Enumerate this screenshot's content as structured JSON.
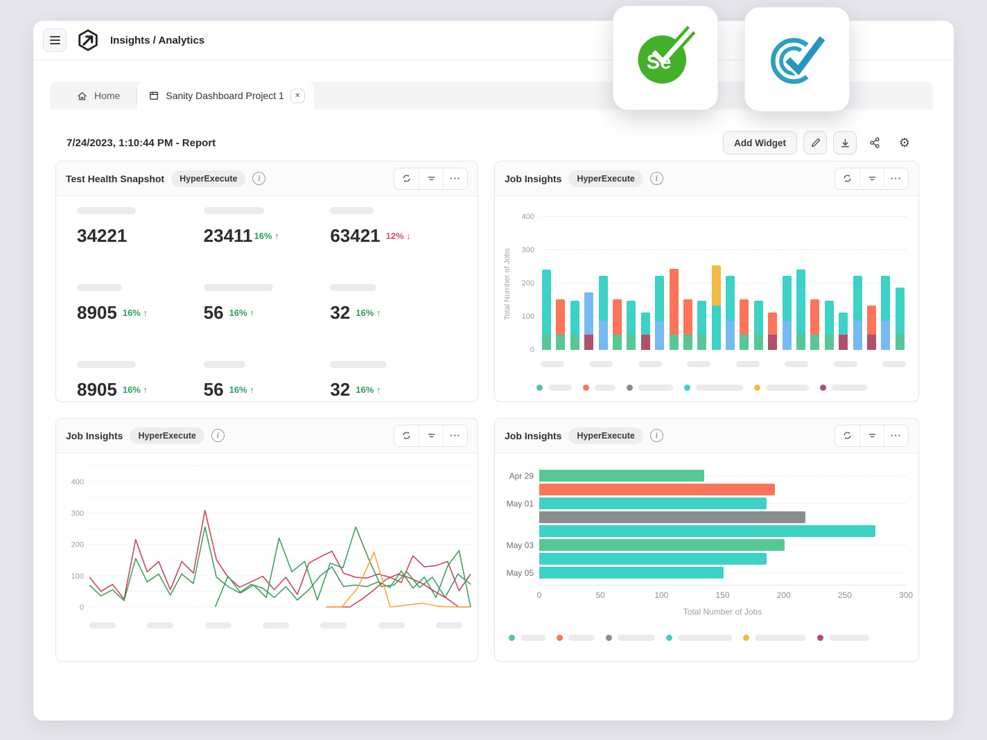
{
  "header": {
    "title": "Insights / Analytics"
  },
  "overlay_cards": {
    "selenium_text": "Se"
  },
  "tabs": {
    "home_label": "Home",
    "active_label": "Sanity Dashboard Project 1",
    "close_glyph": "✕"
  },
  "report": {
    "title": "7/24/2023, 1:10:44 PM - Report",
    "add_widget_label": "Add Widget"
  },
  "colors": {
    "teal": "#3CD2C5",
    "green": "#57C795",
    "orange": "#FC7459",
    "blue": "#75BAF2",
    "maroon": "#B0506B",
    "yellow": "#F2BB45",
    "gray": "#8C8C8C",
    "line_red": "#C2495A",
    "line_green": "#3FA05E",
    "line_yellow": "#F5A93B",
    "delta_up": "#2E9E5B",
    "delta_down": "#D0545E",
    "selenium_green": "#43B02A",
    "codeception_teal": "#2AA0C2"
  },
  "widgets": {
    "test_health": {
      "title": "Test Health Snapshot",
      "badge": "HyperExecute",
      "stats": [
        {
          "pill_w": 85,
          "value": "34221",
          "delta": "",
          "dir": ""
        },
        {
          "pill_w": 87,
          "value": "23411",
          "delta": "16%",
          "dir": "up",
          "tight": true
        },
        {
          "pill_w": 63,
          "value": "63421",
          "delta": "12%",
          "dir": "down"
        },
        {
          "pill_w": 65,
          "value": "8905",
          "delta": "16%",
          "dir": "up"
        },
        {
          "pill_w": 100,
          "value": "56",
          "delta": "16%",
          "dir": "up"
        },
        {
          "pill_w": 67,
          "value": "32",
          "delta": "16%",
          "dir": "up"
        },
        {
          "pill_w": 85,
          "value": "8905",
          "delta": "16%",
          "dir": "up"
        },
        {
          "pill_w": 60,
          "value": "56",
          "delta": "16%",
          "dir": "up"
        },
        {
          "pill_w": 82,
          "value": "32",
          "delta": "16%",
          "dir": "up"
        }
      ]
    },
    "job_insights_bar": {
      "title": "Job Insights",
      "badge": "HyperExecute"
    },
    "job_insights_line": {
      "title": "Job Insights",
      "badge": "HyperExecute"
    },
    "job_insights_hbar": {
      "title": "Job Insights",
      "badge": "HyperExecute"
    }
  },
  "chart_data": [
    {
      "type": "bar",
      "stacked": true,
      "title": "Job Insights",
      "ylabel": "Total Number of Jobs",
      "ylim": [
        0,
        400
      ],
      "yticks": [
        0,
        100,
        200,
        300,
        400
      ],
      "grid": true,
      "x_labels_loading": {
        "count": 8,
        "pill_width": 34
      },
      "bars": [
        [
          [
            "green",
            45
          ],
          [
            "teal",
            197
          ]
        ],
        [
          [
            "green",
            45
          ],
          [
            "orange",
            107
          ]
        ],
        [
          [
            "green",
            45
          ],
          [
            "teal",
            102
          ]
        ],
        [
          [
            "maroon",
            45
          ],
          [
            "blue",
            127
          ]
        ],
        [
          [
            "blue",
            87
          ],
          [
            "teal",
            135
          ]
        ],
        [
          [
            "green",
            45
          ],
          [
            "orange",
            107
          ]
        ],
        [
          [
            "green",
            45
          ],
          [
            "teal",
            102
          ]
        ],
        [
          [
            "maroon",
            45
          ],
          [
            "teal",
            68
          ]
        ],
        [
          [
            "blue",
            87
          ],
          [
            "teal",
            135
          ]
        ],
        [
          [
            "green",
            45
          ],
          [
            "orange",
            198
          ]
        ],
        [
          [
            "green",
            45
          ],
          [
            "orange",
            107
          ]
        ],
        [
          [
            "green",
            45
          ],
          [
            "teal",
            102
          ]
        ],
        [
          [
            "teal",
            133
          ],
          [
            "yellow",
            122
          ]
        ],
        [
          [
            "blue",
            87
          ],
          [
            "teal",
            135
          ]
        ],
        [
          [
            "green",
            45
          ],
          [
            "orange",
            107
          ]
        ],
        [
          [
            "green",
            45
          ],
          [
            "teal",
            102
          ]
        ],
        [
          [
            "maroon",
            45
          ],
          [
            "orange",
            68
          ]
        ],
        [
          [
            "blue",
            87
          ],
          [
            "teal",
            135
          ]
        ],
        [
          [
            "green",
            45
          ],
          [
            "teal",
            197
          ]
        ],
        [
          [
            "green",
            45
          ],
          [
            "orange",
            107
          ]
        ],
        [
          [
            "green",
            45
          ],
          [
            "teal",
            102
          ]
        ],
        [
          [
            "maroon",
            45
          ],
          [
            "teal",
            68
          ]
        ],
        [
          [
            "blue",
            87
          ],
          [
            "teal",
            135
          ]
        ],
        [
          [
            "maroon",
            45
          ],
          [
            "orange",
            88
          ]
        ],
        [
          [
            "blue",
            87
          ],
          [
            "teal",
            135
          ]
        ],
        [
          [
            "green",
            45
          ],
          [
            "teal",
            142
          ]
        ]
      ],
      "legend": {
        "dots": [
          "green",
          "orange",
          "gray",
          "teal",
          "yellow",
          "maroon"
        ],
        "pill_widths": [
          34,
          30,
          50,
          68,
          62,
          52
        ]
      }
    },
    {
      "type": "line",
      "title": "Job Insights",
      "ylim": [
        0,
        450
      ],
      "yticks": [
        0,
        100,
        200,
        300,
        400
      ],
      "grid_step": 50,
      "grid": true,
      "x_labels_loading": {
        "count": 7,
        "pill_width": 38
      },
      "series": [
        {
          "color_key": "line_red",
          "start": 0,
          "values": [
            95,
            50,
            72,
            25,
            215,
            112,
            145,
            55,
            145,
            108,
            308,
            150,
            95,
            63,
            80,
            98,
            55,
            95,
            40,
            140,
            160,
            178,
            108,
            95,
            92,
            105,
            95,
            78,
            163,
            128,
            132,
            145,
            52,
            105
          ]
        },
        {
          "color_key": "line_green",
          "start": 0,
          "values": [
            70,
            35,
            55,
            20,
            155,
            80,
            105,
            38,
            105,
            75,
            255,
            95,
            65,
            45,
            72,
            60,
            30,
            65,
            22,
            55,
            100,
            128,
            65,
            70,
            65,
            80,
            62,
            115,
            60,
            95,
            30,
            130,
            180,
            0
          ]
        },
        {
          "color_key": "line_green",
          "start": 0.33,
          "values": [
            0,
            98,
            45,
            70,
            30,
            220,
            112,
            145,
            22,
            140,
            125,
            255,
            155,
            65,
            70,
            112,
            62,
            95,
            30,
            105,
            72
          ]
        },
        {
          "color_key": "line_red",
          "start": 0.62,
          "values": [
            0,
            0,
            0,
            25,
            55,
            88,
            105,
            92,
            75,
            50,
            28,
            0,
            0
          ]
        },
        {
          "color_key": "line_yellow",
          "start": 0.62,
          "values": [
            0,
            0,
            62,
            175,
            0,
            6,
            12,
            2,
            0,
            0
          ]
        }
      ]
    },
    {
      "type": "bar",
      "orientation": "horizontal",
      "title": "Job Insights",
      "xlabel": "Total Number of Jobs",
      "xlim": [
        0,
        300
      ],
      "xticks": [
        0,
        50,
        100,
        150,
        200,
        250,
        300
      ],
      "categories": [
        {
          "row": 0,
          "label": "Apr 29"
        },
        {
          "row": 2,
          "label": "May 01"
        },
        {
          "row": 5,
          "label": "May 03"
        },
        {
          "row": 7,
          "label": "May 05"
        }
      ],
      "bars": [
        {
          "color": "green",
          "value": 135
        },
        {
          "color": "orange",
          "value": 193
        },
        {
          "color": "teal",
          "value": 186
        },
        {
          "color": "gray",
          "value": 218,
          "dotted": true
        },
        {
          "color": "teal",
          "value": 275
        },
        {
          "color": "green",
          "value": 201
        },
        {
          "color": "teal",
          "value": 186
        },
        {
          "color": "teal",
          "value": 151
        }
      ],
      "legend": {
        "dots": [
          "green",
          "orange",
          "gray",
          "teal",
          "yellow",
          "maroon"
        ],
        "pill_widths": [
          36,
          38,
          54,
          78,
          74,
          58
        ]
      }
    }
  ]
}
